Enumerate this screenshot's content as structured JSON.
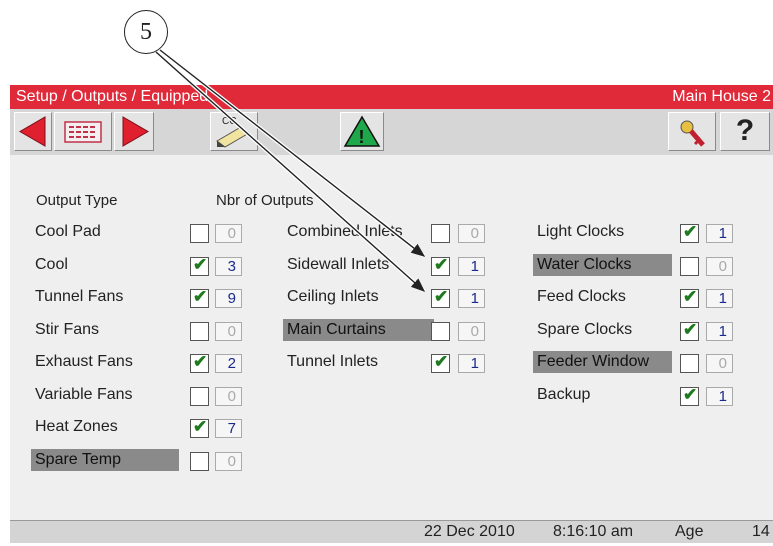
{
  "callout_number": "5",
  "titlebar": {
    "breadcrumb": "Setup / Outputs / Equipped",
    "house": "Main House 2"
  },
  "toolbar": {
    "prev_icon": "left-arrow-icon",
    "menu_icon": "list-icon",
    "next_icon": "right-arrow-icon",
    "cc_icon": "cc-pencil-icon",
    "cc_label": "CC",
    "alarm_icon": "warning-triangle-icon",
    "alarm_symbol": "!",
    "key_icon": "key-icon",
    "help_label": "?"
  },
  "headers": {
    "output_type": "Output Type",
    "nbr_outputs": "Nbr of Outputs"
  },
  "columns": [
    [
      {
        "label": "Cool Pad",
        "checked": false,
        "value": "0",
        "highlight": false
      },
      {
        "label": "Cool",
        "checked": true,
        "value": "3",
        "highlight": false
      },
      {
        "label": "Tunnel Fans",
        "checked": true,
        "value": "9",
        "highlight": false
      },
      {
        "label": "Stir Fans",
        "checked": false,
        "value": "0",
        "highlight": false
      },
      {
        "label": "Exhaust Fans",
        "checked": true,
        "value": "2",
        "highlight": false
      },
      {
        "label": "Variable Fans",
        "checked": false,
        "value": "0",
        "highlight": false
      },
      {
        "label": "Heat Zones",
        "checked": true,
        "value": "7",
        "highlight": false
      },
      {
        "label": "Spare Temp",
        "checked": false,
        "value": "0",
        "highlight": true
      }
    ],
    [
      {
        "label": "Combined Inlets",
        "checked": false,
        "value": "0",
        "highlight": false
      },
      {
        "label": "Sidewall Inlets",
        "checked": true,
        "value": "1",
        "highlight": false
      },
      {
        "label": "Ceiling Inlets",
        "checked": true,
        "value": "1",
        "highlight": false
      },
      {
        "label": "Main Curtains",
        "checked": false,
        "value": "0",
        "highlight": true
      },
      {
        "label": "Tunnel Inlets",
        "checked": true,
        "value": "1",
        "highlight": false
      }
    ],
    [
      {
        "label": "Light Clocks",
        "checked": true,
        "value": "1",
        "highlight": false
      },
      {
        "label": "Water Clocks",
        "checked": false,
        "value": "0",
        "highlight": true
      },
      {
        "label": "Feed Clocks",
        "checked": true,
        "value": "1",
        "highlight": false
      },
      {
        "label": "Spare Clocks",
        "checked": true,
        "value": "1",
        "highlight": false
      },
      {
        "label": "Feeder Window",
        "checked": false,
        "value": "0",
        "highlight": true
      },
      {
        "label": "Backup",
        "checked": true,
        "value": "1",
        "highlight": false
      }
    ]
  ],
  "status": {
    "date": "22 Dec 2010",
    "time": "8:16:10 am",
    "age_label": "Age",
    "age_value": "14"
  },
  "colors": {
    "titlebar": "#e02a3a",
    "arrow_red": "#e0202f",
    "check_green": "#1f7a1f",
    "warning_green": "#1ea84a"
  }
}
